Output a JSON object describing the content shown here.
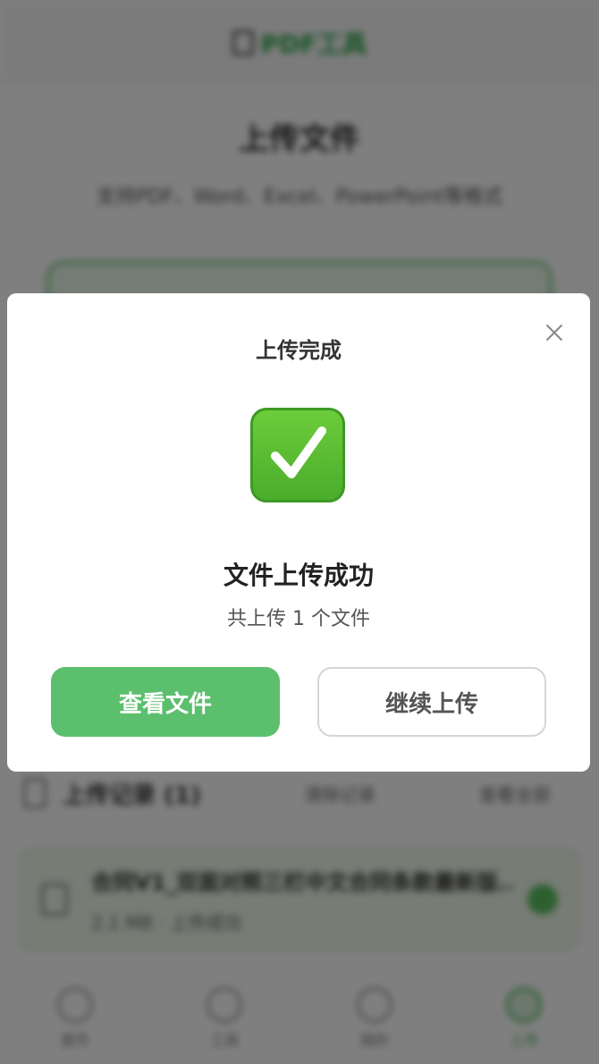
{
  "background": {
    "app_name": "PDF工具",
    "title": "上传文件",
    "subtitle": "支持PDF、Word、Excel、PowerPoint等格式",
    "records": {
      "title": "上传记录 (1)",
      "link_1": "清除记录",
      "link_2": "查看全部"
    },
    "file_card": {
      "name": "合同V1_双面对照三栏中文合同条款最新版...",
      "meta": "2.1 MB · 上传成功"
    },
    "nav": [
      {
        "label": "首页",
        "icon": "home-icon"
      },
      {
        "label": "工具",
        "icon": "tools-icon"
      },
      {
        "label": "我的",
        "icon": "user-icon"
      },
      {
        "label": "上传",
        "icon": "upload-icon",
        "active": true
      }
    ]
  },
  "modal": {
    "title": "上传完成",
    "icon": "check-mark-icon",
    "heading": "文件上传成功",
    "count_text": "共上传 1 个文件",
    "primary_button": "查看文件",
    "secondary_button": "继续上传"
  },
  "colors": {
    "accent": "#5cbf6e",
    "overlay": "rgba(0,0,0,0.5)"
  }
}
